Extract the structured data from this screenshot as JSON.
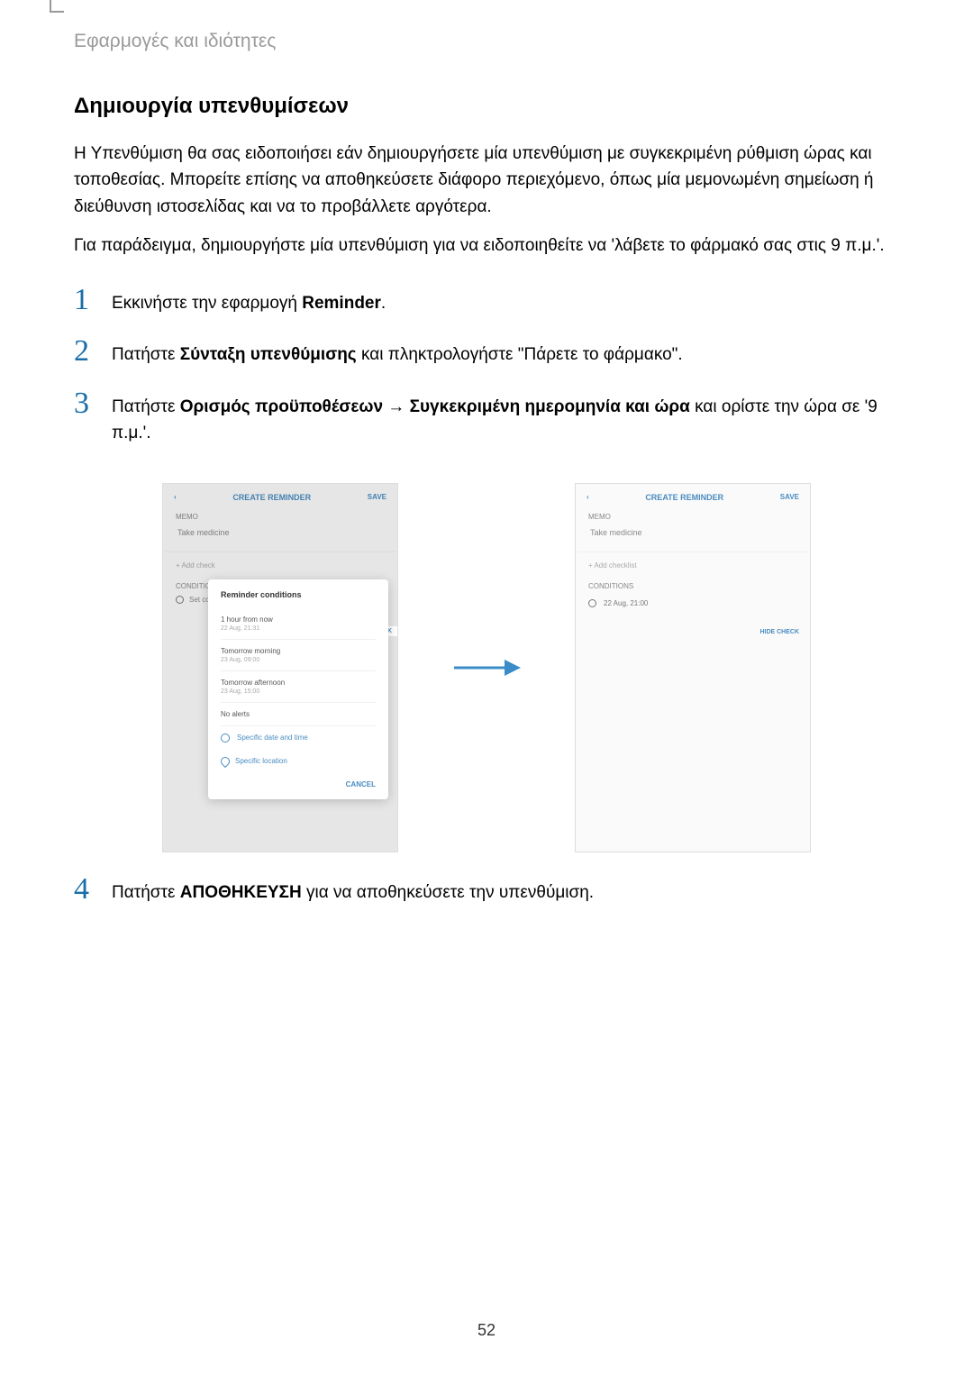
{
  "section_header": "Εφαρμογές και ιδιότητες",
  "heading": "Δημιουργία υπενθυμίσεων",
  "para1": "Η Υπενθύμιση θα σας ειδοποιήσει εάν δημιουργήσετε μία υπενθύμιση με συγκεκριμένη ρύθμιση ώρας και τοποθεσίας. Μπορείτε επίσης να αποθηκεύσετε διάφορο περιεχόμενο, όπως μία μεμονωμένη σημείωση ή διεύθυνση ιστοσελίδας και να το προβάλλετε αργότερα.",
  "para2": "Για παράδειγμα, δημιουργήστε μία υπενθύμιση για να ειδοποιηθείτε να 'λάβετε το φάρμακό σας στις 9 π.μ.'.",
  "steps": {
    "s1": {
      "num": "1",
      "pre": "Εκκινήστε την εφαρμογή ",
      "bold": "Reminder",
      "post": "."
    },
    "s2": {
      "num": "2",
      "pre": "Πατήστε ",
      "bold": "Σύνταξη υπενθύμισης",
      "post": " και πληκτρολογήστε \"Πάρετε το φάρμακο\"."
    },
    "s3": {
      "num": "3",
      "pre": "Πατήστε ",
      "bold1": "Ορισμός προϋποθέσεων",
      "mid": " → ",
      "bold2": "Συγκεκριμένη ημερομηνία και ώρα",
      "post": " και ορίστε την ώρα σε '9 π.μ.'."
    },
    "s4": {
      "num": "4",
      "pre": "Πατήστε ",
      "bold": "ΑΠΟΘΗΚΕΥΣΗ",
      "post": " για να αποθηκεύσετε την υπενθύμιση."
    }
  },
  "mockup_left": {
    "title": "CREATE REMINDER",
    "save": "SAVE",
    "memo": "MEMO",
    "input": "Take medicine",
    "add_check": "+ Add check",
    "conditions_label": "CONDITIONS",
    "setcond": "Set cond",
    "hide": "HIDE CHECK",
    "popup": {
      "title": "Reminder conditions",
      "item1_title": "1 hour from now",
      "item1_sub": "22 Aug, 21:31",
      "item2_title": "Tomorrow morning",
      "item2_sub": "23 Aug, 09:00",
      "item3_title": "Tomorrow afternoon",
      "item3_sub": "23 Aug, 15:00",
      "item4_title": "No alerts",
      "link1": "Specific date and time",
      "link2": "Specific location",
      "cancel": "CANCEL"
    }
  },
  "mockup_right": {
    "title": "CREATE REMINDER",
    "save": "SAVE",
    "memo": "MEMO",
    "input": "Take medicine",
    "add_check": "+ Add checklist",
    "conditions_label": "CONDITIONS",
    "datetime": "22 Aug, 21:00",
    "hide": "HIDE CHECK"
  },
  "page_number": "52"
}
